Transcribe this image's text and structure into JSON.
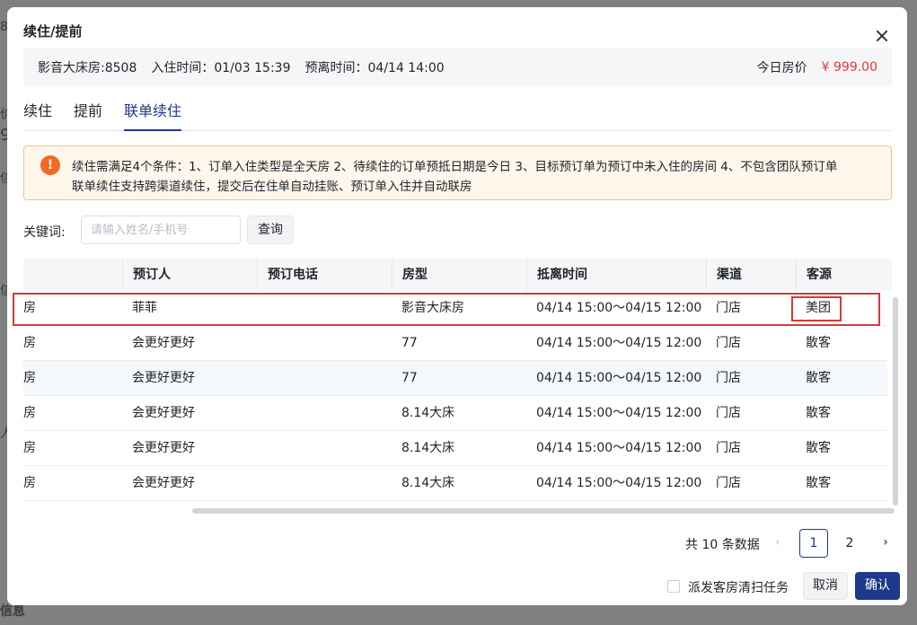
{
  "background": {
    "fragments": [
      "8",
      "价",
      "9",
      "信",
      "信",
      "人",
      "信息"
    ]
  },
  "modal": {
    "title": "续住/提前",
    "info": {
      "room": "影音大床房:8508",
      "checkin": "入住时间：01/03 15:39",
      "checkout": "预离时间：04/14 14:00",
      "price_label": "今日房价",
      "price": "¥ 999.00"
    },
    "tabs": [
      {
        "label": "续住",
        "active": false
      },
      {
        "label": "提前",
        "active": false
      },
      {
        "label": "联单续住",
        "active": true
      }
    ],
    "alert": {
      "line1": "续住需满足4个条件：1、订单入住类型是全天房 2、待续住的订单预抵日期是今日 3、目标预订单为预订中未入住的房间 4、不包含团队预订单",
      "line2": "联单续住支持跨渠道续住，提交后在住单自动挂账、预订单入住并自动联房"
    },
    "search": {
      "label": "关键词:",
      "placeholder": "请输入姓名/手机号",
      "button": "查询"
    },
    "table": {
      "columns": [
        "预订人",
        "预订电话",
        "房型",
        "抵离时间",
        "渠道",
        "客源"
      ],
      "rows": [
        {
          "prefix": "房",
          "booker": "菲菲",
          "phone": "",
          "room_type": "影音大床房",
          "time": "04/14 15:00～04/15 12:00",
          "channel": "门店",
          "source": "美团"
        },
        {
          "prefix": "房",
          "booker": "会更好更好",
          "phone": "",
          "room_type": "77",
          "time": "04/14 15:00～04/15 12:00",
          "channel": "门店",
          "source": "散客"
        },
        {
          "prefix": "房",
          "booker": "会更好更好",
          "phone": "",
          "room_type": "77",
          "time": "04/14 15:00～04/15 12:00",
          "channel": "门店",
          "source": "散客"
        },
        {
          "prefix": "房",
          "booker": "会更好更好",
          "phone": "",
          "room_type": "8.14大床",
          "time": "04/14 15:00～04/15 12:00",
          "channel": "门店",
          "source": "散客"
        },
        {
          "prefix": "房",
          "booker": "会更好更好",
          "phone": "",
          "room_type": "8.14大床",
          "time": "04/14 15:00～04/15 12:00",
          "channel": "门店",
          "source": "散客"
        },
        {
          "prefix": "房",
          "booker": "会更好更好",
          "phone": "",
          "room_type": "8.14大床",
          "time": "04/14 15:00～04/15 12:00",
          "channel": "门店",
          "source": "散客"
        }
      ]
    },
    "pagination": {
      "total": "共 10 条数据",
      "pages": [
        "1",
        "2"
      ],
      "prev": "‹",
      "next": "›"
    },
    "footer": {
      "checkbox_label": "派发客房清扫任务",
      "cancel": "取消",
      "confirm": "确认"
    },
    "colors": {
      "accent": "#1c3a8a",
      "price": "#e3393c",
      "alert_icon": "#f26a22",
      "highlight": "#d23a3a"
    }
  }
}
